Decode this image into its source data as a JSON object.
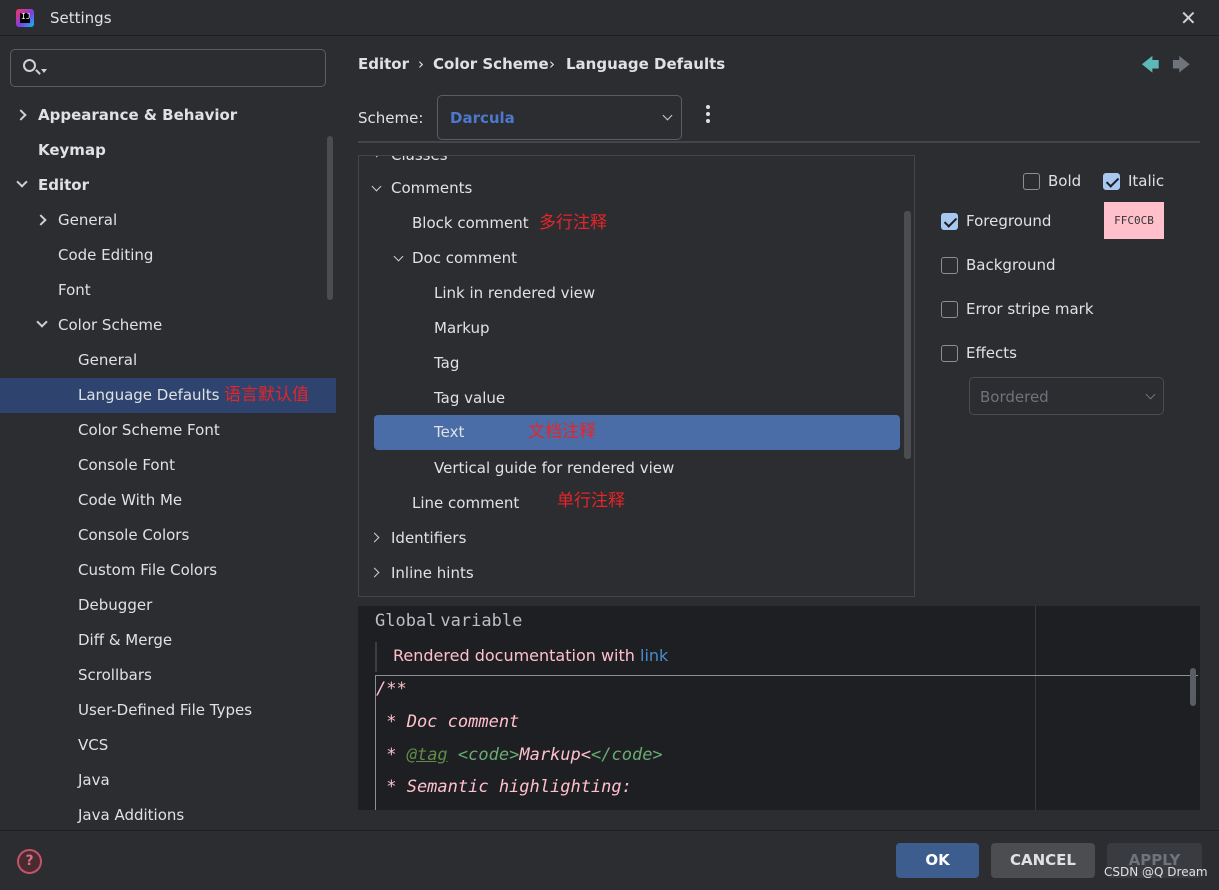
{
  "window": {
    "title": "Settings",
    "close_label": "✕"
  },
  "search": {
    "placeholder": "",
    "value": ""
  },
  "sidebar": {
    "items": [
      {
        "label": "Appearance & Behavior"
      },
      {
        "label": "Keymap"
      },
      {
        "label": "Editor"
      },
      {
        "label": "General"
      },
      {
        "label": "Code Editing"
      },
      {
        "label": "Font"
      },
      {
        "label": "Color Scheme"
      },
      {
        "label": "General"
      },
      {
        "label": "Language Defaults",
        "annotation": "语言默认值"
      },
      {
        "label": "Color Scheme Font"
      },
      {
        "label": "Console Font"
      },
      {
        "label": "Code With Me"
      },
      {
        "label": "Console Colors"
      },
      {
        "label": "Custom File Colors"
      },
      {
        "label": "Debugger"
      },
      {
        "label": "Diff & Merge"
      },
      {
        "label": "Scrollbars"
      },
      {
        "label": "User-Defined File Types"
      },
      {
        "label": "VCS"
      },
      {
        "label": "Java"
      },
      {
        "label": "Java Additions"
      }
    ]
  },
  "breadcrumb": {
    "items": [
      "Editor",
      "Color Scheme",
      "Language Defaults"
    ],
    "separator": "›"
  },
  "nav": {
    "back": "🡄",
    "forward": "🡆"
  },
  "scheme": {
    "label": "Scheme:",
    "value": "Darcula"
  },
  "tree": {
    "items": [
      {
        "label": "Classes"
      },
      {
        "label": "Comments"
      },
      {
        "label": "Block comment",
        "annotation": "多行注释"
      },
      {
        "label": "Doc comment"
      },
      {
        "label": "Link in rendered view"
      },
      {
        "label": "Markup"
      },
      {
        "label": "Tag"
      },
      {
        "label": "Tag value"
      },
      {
        "label": "Text",
        "annotation": "文档注释"
      },
      {
        "label": "Vertical guide for rendered view"
      },
      {
        "label": "Line comment",
        "annotation": "单行注释"
      },
      {
        "label": "Identifiers"
      },
      {
        "label": "Inline hints"
      }
    ]
  },
  "options": {
    "bold": {
      "label": "Bold",
      "checked": false
    },
    "italic": {
      "label": "Italic",
      "checked": true
    },
    "foreground": {
      "label": "Foreground",
      "checked": true,
      "color": "FFC0CB"
    },
    "background": {
      "label": "Background",
      "checked": false
    },
    "error_stripe": {
      "label": "Error stripe mark",
      "checked": false
    },
    "effects": {
      "label": "Effects",
      "checked": false,
      "effect_type": "Bordered"
    }
  },
  "preview": {
    "global_line": [
      "Global",
      "variable"
    ],
    "rendered_prefix": "Rendered documentation with ",
    "rendered_link": "link",
    "lines": {
      "l1": "/**",
      "l2": " * Doc comment",
      "l3_prefix": " * ",
      "l3_tag": "@tag",
      "l3_open": "<code>",
      "l3_text": "Markup",
      "l3_lt": "<",
      "l3_close": "</code>",
      "l4": " * Semantic highlighting:"
    }
  },
  "footer": {
    "help": "?",
    "ok": "OK",
    "cancel": "CANCEL",
    "apply": "APPLY",
    "watermark": "CSDN @Q Dream"
  },
  "colors": {
    "accent": "#3e5d8f",
    "selection": "#2e436e",
    "annotation": "#e5252a",
    "doc_comment": "#ffc0cb",
    "link": "#4d8ccc"
  }
}
